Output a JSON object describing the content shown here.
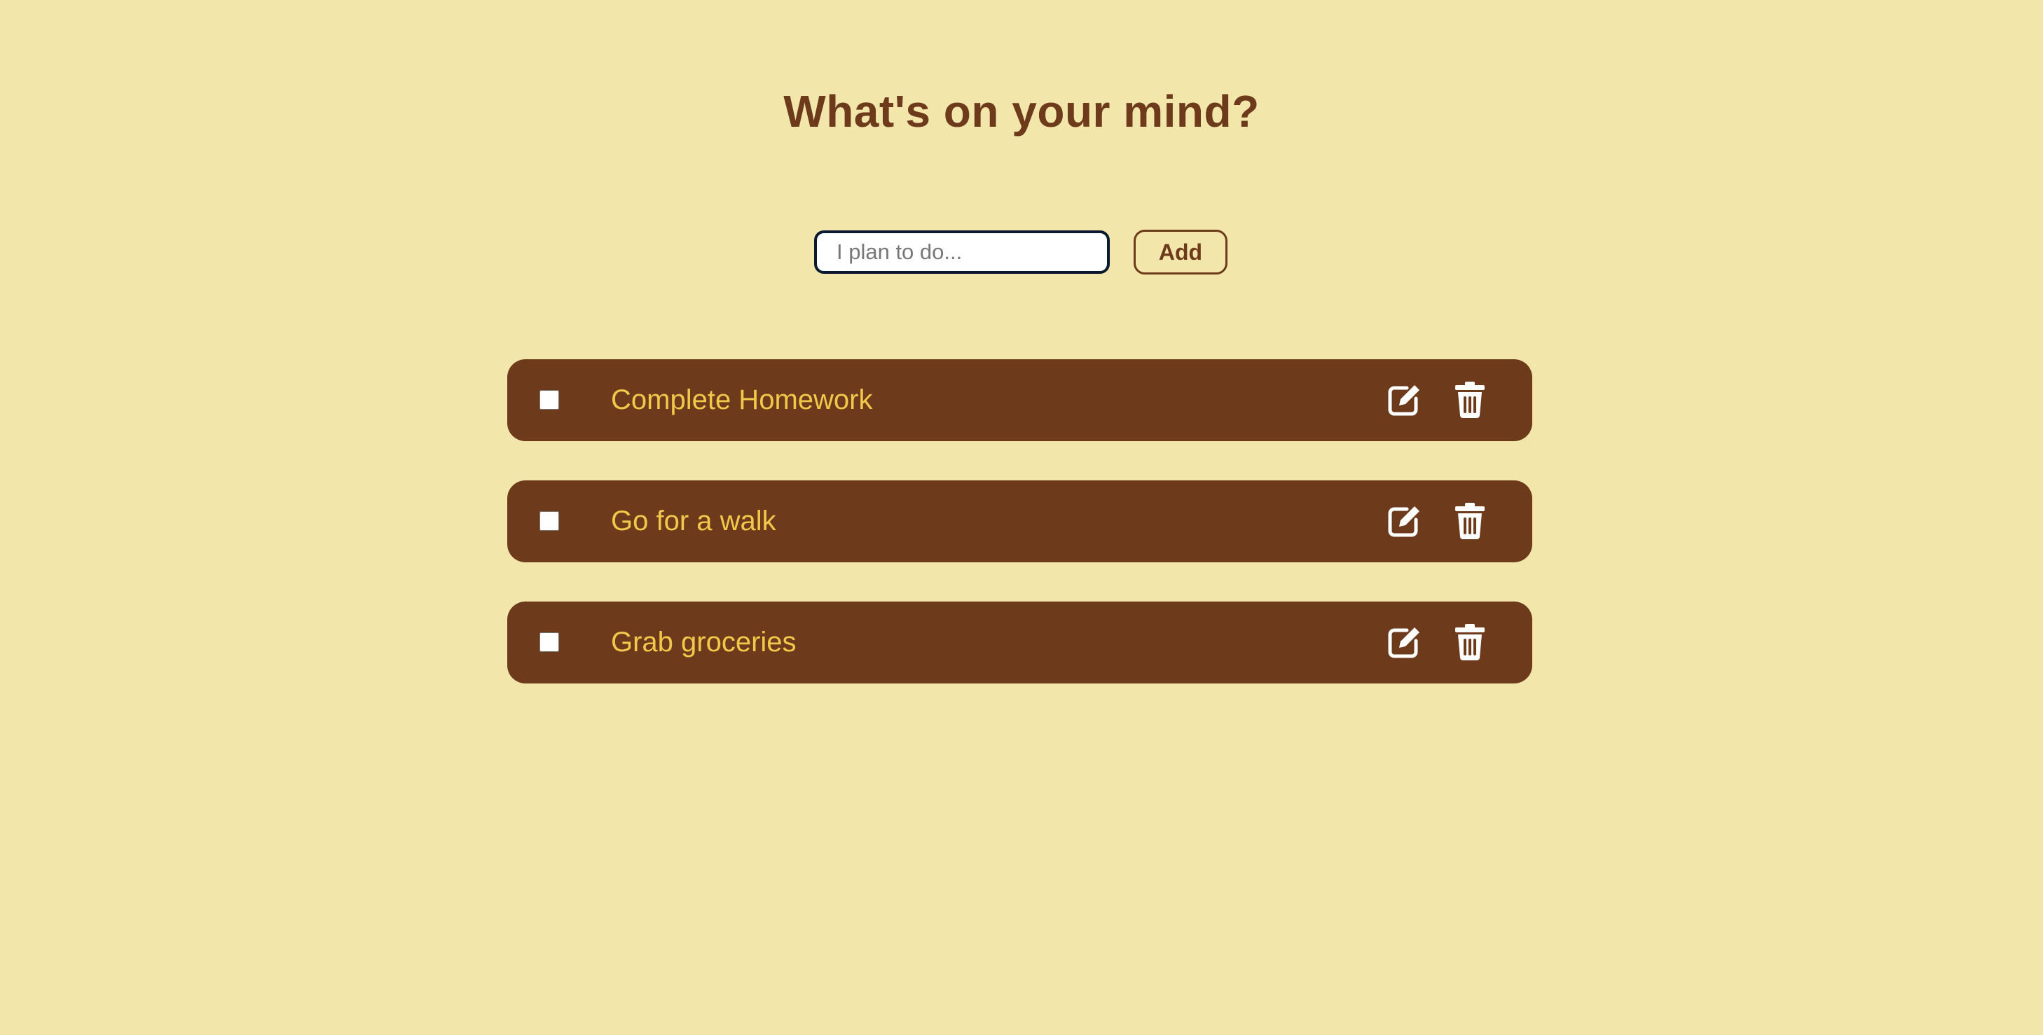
{
  "header": {
    "title": "What's on your mind?"
  },
  "form": {
    "input_placeholder": "I plan to do...",
    "input_value": "",
    "add_label": "Add"
  },
  "todos": [
    {
      "text": "Complete Homework",
      "checked": false
    },
    {
      "text": "Go for a walk",
      "checked": false
    },
    {
      "text": "Grab groceries",
      "checked": false
    }
  ],
  "icons": {
    "edit": "edit-icon",
    "delete": "trash-icon"
  },
  "colors": {
    "background": "#f3e6aa",
    "accent": "#6d3b1c",
    "item_text": "#f2c84b",
    "icon": "#ffffff"
  }
}
